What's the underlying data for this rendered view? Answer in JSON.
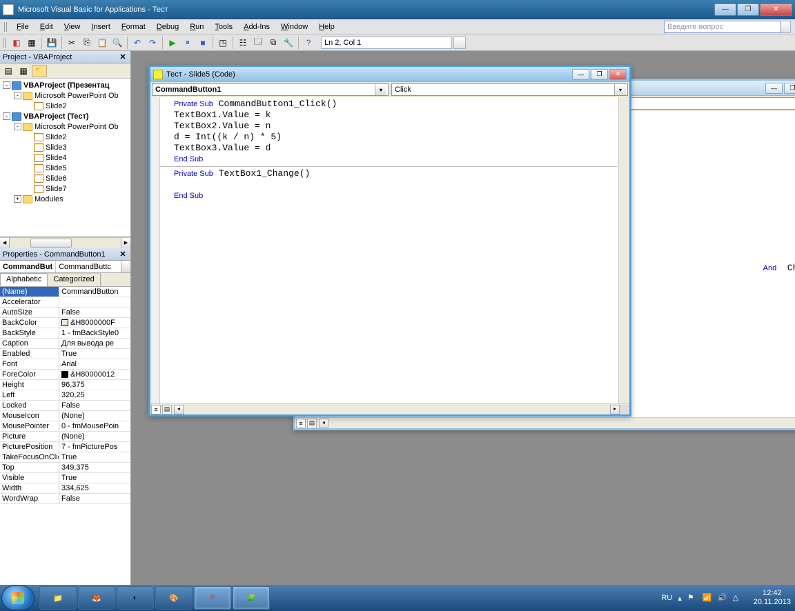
{
  "titlebar": {
    "title": "Microsoft Visual Basic for Applications - Тест"
  },
  "menubar": {
    "items": [
      "File",
      "Edit",
      "View",
      "Insert",
      "Format",
      "Debug",
      "Run",
      "Tools",
      "Add-Ins",
      "Window",
      "Help"
    ],
    "question_placeholder": "Введите вопрос"
  },
  "toolbar": {
    "status": "Ln 2, Col 1"
  },
  "project_panel": {
    "title": "Project - VBAProject",
    "tree": [
      {
        "level": 0,
        "toggle": "-",
        "icon": "vba",
        "label": "VBAProject (Презентац",
        "bold": true
      },
      {
        "level": 1,
        "toggle": "-",
        "icon": "folder",
        "label": "Microsoft PowerPoint Ob"
      },
      {
        "level": 2,
        "toggle": "",
        "icon": "slide",
        "label": "Slide2"
      },
      {
        "level": 0,
        "toggle": "-",
        "icon": "vba",
        "label": "VBAProject (Тест)",
        "bold": true
      },
      {
        "level": 1,
        "toggle": "-",
        "icon": "folder",
        "label": "Microsoft PowerPoint Ob"
      },
      {
        "level": 2,
        "toggle": "",
        "icon": "slide",
        "label": "Slide2"
      },
      {
        "level": 2,
        "toggle": "",
        "icon": "slide",
        "label": "Slide3"
      },
      {
        "level": 2,
        "toggle": "",
        "icon": "slide",
        "label": "Slide4"
      },
      {
        "level": 2,
        "toggle": "",
        "icon": "slide",
        "label": "Slide5"
      },
      {
        "level": 2,
        "toggle": "",
        "icon": "slide",
        "label": "Slide6"
      },
      {
        "level": 2,
        "toggle": "",
        "icon": "slide",
        "label": "Slide7"
      },
      {
        "level": 1,
        "toggle": "+",
        "icon": "folder",
        "label": "Modules"
      }
    ]
  },
  "properties_panel": {
    "title": "Properties - CommandButton1",
    "combo_name": "CommandBut",
    "combo_type": "CommandButtc",
    "tabs": [
      "Alphabetic",
      "Categorized"
    ],
    "rows": [
      {
        "k": "(Name)",
        "v": "CommandButton",
        "sel": true
      },
      {
        "k": "Accelerator",
        "v": ""
      },
      {
        "k": "AutoSize",
        "v": "False"
      },
      {
        "k": "BackColor",
        "v": "&H8000000F",
        "color": "#ece9d8"
      },
      {
        "k": "BackStyle",
        "v": "1 - fmBackStyle0"
      },
      {
        "k": "Caption",
        "v": "Для вывода ре"
      },
      {
        "k": "Enabled",
        "v": "True"
      },
      {
        "k": "Font",
        "v": "Arial"
      },
      {
        "k": "ForeColor",
        "v": "&H80000012",
        "color": "#000000"
      },
      {
        "k": "Height",
        "v": "96,375"
      },
      {
        "k": "Left",
        "v": "320,25"
      },
      {
        "k": "Locked",
        "v": "False"
      },
      {
        "k": "MouseIcon",
        "v": "(None)"
      },
      {
        "k": "MousePointer",
        "v": "0 - fmMousePoin"
      },
      {
        "k": "Picture",
        "v": "(None)"
      },
      {
        "k": "PicturePosition",
        "v": "7 - fmPicturePos"
      },
      {
        "k": "TakeFocusOnClick",
        "v": "True"
      },
      {
        "k": "Top",
        "v": "349,375"
      },
      {
        "k": "Visible",
        "v": "True"
      },
      {
        "k": "Width",
        "v": "334,625"
      },
      {
        "k": "WordWrap",
        "v": "False"
      }
    ]
  },
  "code_window_back": {
    "title": "",
    "left_combo": "",
    "right_combo": "",
    "code_tail": "And  Chec"
  },
  "code_window_front": {
    "title": "Тест - Slide5 (Code)",
    "left_combo": "CommandButton1",
    "right_combo": "Click",
    "code": [
      {
        "t": "kw",
        "s": "Private Sub"
      },
      {
        "t": "",
        "s": " CommandButton1_Click()"
      },
      "NL",
      {
        "t": "",
        "s": "TextBox1.Value = k"
      },
      "NL",
      {
        "t": "",
        "s": "TextBox2.Value = n"
      },
      "NL",
      {
        "t": "",
        "s": "d = Int((k / n) * 5)"
      },
      "NL",
      {
        "t": "",
        "s": "TextBox3.Value = d"
      },
      "NL",
      {
        "t": "kw",
        "s": "End Sub"
      },
      "NL",
      "HR",
      {
        "t": "kw",
        "s": "Private Sub"
      },
      {
        "t": "",
        "s": " TextBox1_Change()"
      },
      "NL",
      "NL",
      {
        "t": "kw",
        "s": "End Sub"
      }
    ]
  },
  "taskbar": {
    "lang": "RU",
    "time": "12:42",
    "date": "20.11.2013"
  }
}
